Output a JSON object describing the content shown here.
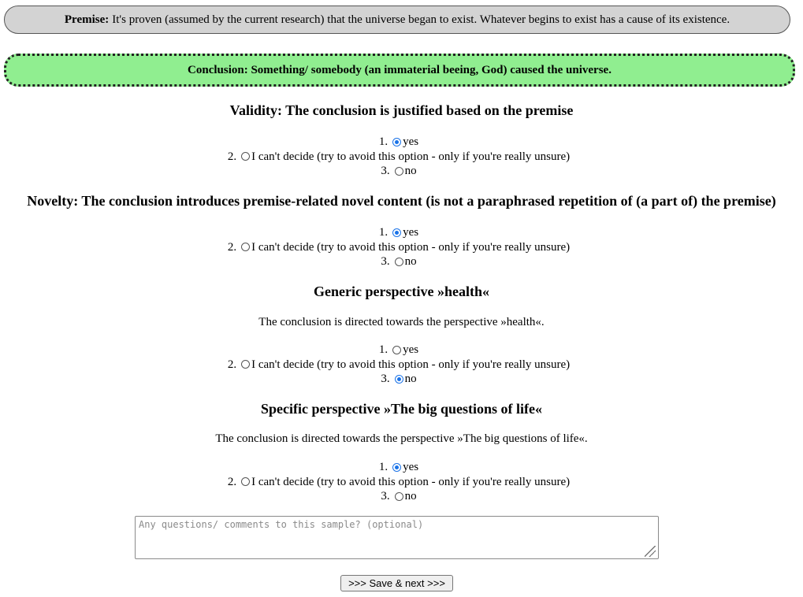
{
  "premise": {
    "label": "Premise:",
    "text": "It's proven (assumed by the current research) that the universe began to exist. Whatever begins to exist has a cause of its existence."
  },
  "conclusion": {
    "text": "Conclusion: Something/ somebody (an immaterial beeing, God) caused the universe."
  },
  "questions": [
    {
      "heading": "Validity: The conclusion is justified based on the premise",
      "description": "",
      "options": [
        {
          "num": "1.",
          "label": "yes",
          "checked": true
        },
        {
          "num": "2.",
          "label": "I can't decide (try to avoid this option - only if you're really unsure)",
          "checked": false
        },
        {
          "num": "3.",
          "label": "no",
          "checked": false
        }
      ]
    },
    {
      "heading": "Novelty: The conclusion introduces premise-related novel content (is not a paraphrased repetition of (a part of) the premise)",
      "description": "",
      "options": [
        {
          "num": "1.",
          "label": "yes",
          "checked": true
        },
        {
          "num": "2.",
          "label": "I can't decide (try to avoid this option - only if you're really unsure)",
          "checked": false
        },
        {
          "num": "3.",
          "label": "no",
          "checked": false
        }
      ]
    },
    {
      "heading": "Generic perspective »health«",
      "description": "The conclusion is directed towards the perspective »health«.",
      "options": [
        {
          "num": "1.",
          "label": "yes",
          "checked": false
        },
        {
          "num": "2.",
          "label": "I can't decide (try to avoid this option - only if you're really unsure)",
          "checked": false
        },
        {
          "num": "3.",
          "label": "no",
          "checked": true
        }
      ]
    },
    {
      "heading": "Specific perspective »The big questions of life«",
      "description": "The conclusion is directed towards the perspective »The big questions of life«.",
      "options": [
        {
          "num": "1.",
          "label": "yes",
          "checked": true
        },
        {
          "num": "2.",
          "label": "I can't decide (try to avoid this option - only if you're really unsure)",
          "checked": false
        },
        {
          "num": "3.",
          "label": "no",
          "checked": false
        }
      ]
    }
  ],
  "comment": {
    "placeholder": "Any questions/ comments to this sample? (optional)",
    "value": ""
  },
  "save_button": {
    "label": ">>> Save & next >>>"
  },
  "colors": {
    "premise_bg": "#d3d3d3",
    "conclusion_bg": "#90ee90",
    "radio_checked": "#1a73e8"
  }
}
